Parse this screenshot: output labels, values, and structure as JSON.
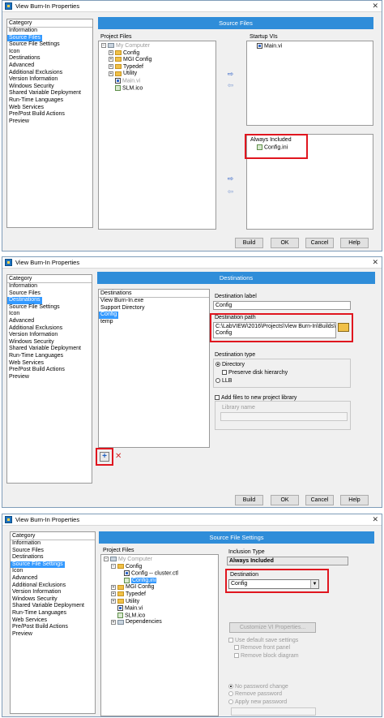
{
  "categories": [
    "Information",
    "Source Files",
    "Source File Settings",
    "Icon",
    "Destinations",
    "Advanced",
    "Additional Exclusions",
    "Version Information",
    "Windows Security",
    "Shared Variable Deployment",
    "Run-Time Languages",
    "Web Services",
    "Pre/Post Build Actions",
    "Preview"
  ],
  "buttons": {
    "build": "Build",
    "ok": "OK",
    "cancel": "Cancel",
    "help": "Help"
  },
  "w1": {
    "title": "View Burn-In Properties",
    "category_label": "Category",
    "header": "Source Files",
    "project_files_label": "Project Files",
    "tree": [
      "My Computer",
      "Config",
      "MGI Config",
      "Typedef",
      "Utility",
      "Main.vi",
      "SLM.ico"
    ],
    "startup_label": "Startup VIs",
    "startup_items": [
      "Main.vi"
    ],
    "always_label": "Always Included",
    "always_items": [
      "Config.ini"
    ],
    "arrows": [
      "⇨",
      "⇦",
      "⇨",
      "⇦"
    ]
  },
  "w2": {
    "title": "View Burn-In Properties",
    "category_label": "Category",
    "header": "Destinations",
    "destinations_label": "Destinations",
    "destinations": [
      "View Burn-In.exe",
      "Support Directory",
      "Config",
      "temp"
    ],
    "dest_label_label": "Destination label",
    "dest_label_value": "Config",
    "dest_path_label": "Destination path",
    "dest_path_value_1": "C:\\LabVIEW\\2016\\Projects\\View Burn-In\\Builds\\",
    "dest_path_value_2": "Config",
    "dest_type_label": "Destination type",
    "directory": "Directory",
    "preserve": "Preserve disk hierarchy",
    "llb": "LLB",
    "add_files": "Add files to new project library",
    "library_name": "Library name",
    "add_symbol": "+",
    "remove_symbol": "✕"
  },
  "w3": {
    "title": "View Burn-In Properties",
    "category_label": "Category",
    "header": "Source File Settings",
    "project_files_label": "Project Files",
    "tree": [
      "My Computer",
      "Config",
      "Config -- cluster.ctl",
      "Config.ini",
      "MGI Config",
      "Typedef",
      "Utility",
      "Main.vi",
      "SLM.ico",
      "Dependencies"
    ],
    "inclusion_type_label": "Inclusion Type",
    "inclusion_type_value": "Always Included",
    "destination_label": "Destination",
    "destination_value": "Config",
    "customize": "Customize VI Properties...",
    "use_default": "Use default save settings",
    "remove_front": "Remove front panel",
    "remove_block": "Remove block diagram",
    "no_password": "No password change",
    "remove_password": "Remove password",
    "apply_password": "Apply new password"
  }
}
